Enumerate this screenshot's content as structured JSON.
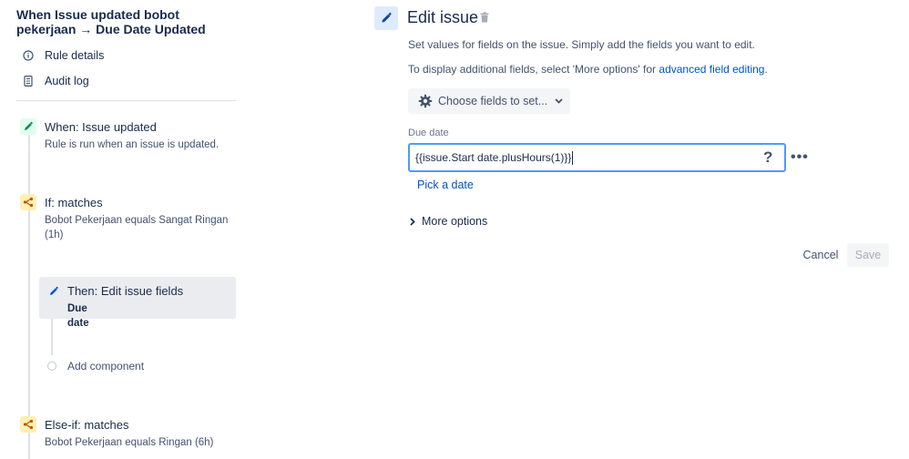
{
  "rule": {
    "title": "When Issue updated bobot pekerjaan → Due Date Updated",
    "nav": [
      {
        "label": "Rule details",
        "icon": "info-icon"
      },
      {
        "label": "Audit log",
        "icon": "document-icon"
      }
    ]
  },
  "components": {
    "when": {
      "title": "When: Issue updated",
      "desc": "Rule is run when an issue is updated."
    },
    "if": {
      "title": "If: matches",
      "desc": "Bobot Pekerjaan equals Sangat Ringan (1h)"
    },
    "then": {
      "title": "Then: Edit issue fields",
      "desc": "Due date"
    },
    "add": {
      "label": "Add component"
    },
    "else_if": {
      "title": "Else-if: matches",
      "desc": "Bobot Pekerjaan equals Ringan (6h)"
    }
  },
  "editor": {
    "title": "Edit issue",
    "help1": "Set values for fields on the issue. Simply add the fields you want to edit.",
    "help2_prefix": "To display additional fields, select 'More options' for ",
    "help2_link": "advanced field editing",
    "help2_suffix": ".",
    "choose_fields": "Choose fields to set...",
    "field_label": "Due date",
    "field_value": "{{issue.Start date.plusHours(1)}}",
    "help_symbol": "?",
    "more_symbol": "•••",
    "pick_date": "Pick a date",
    "more_options": "More options",
    "cancel": "Cancel",
    "save": "Save"
  },
  "colors": {
    "accent": "#0052cc",
    "focus": "#4c9aff",
    "trigger_green": "#00875a",
    "condition_yellow": "#ff991f"
  }
}
